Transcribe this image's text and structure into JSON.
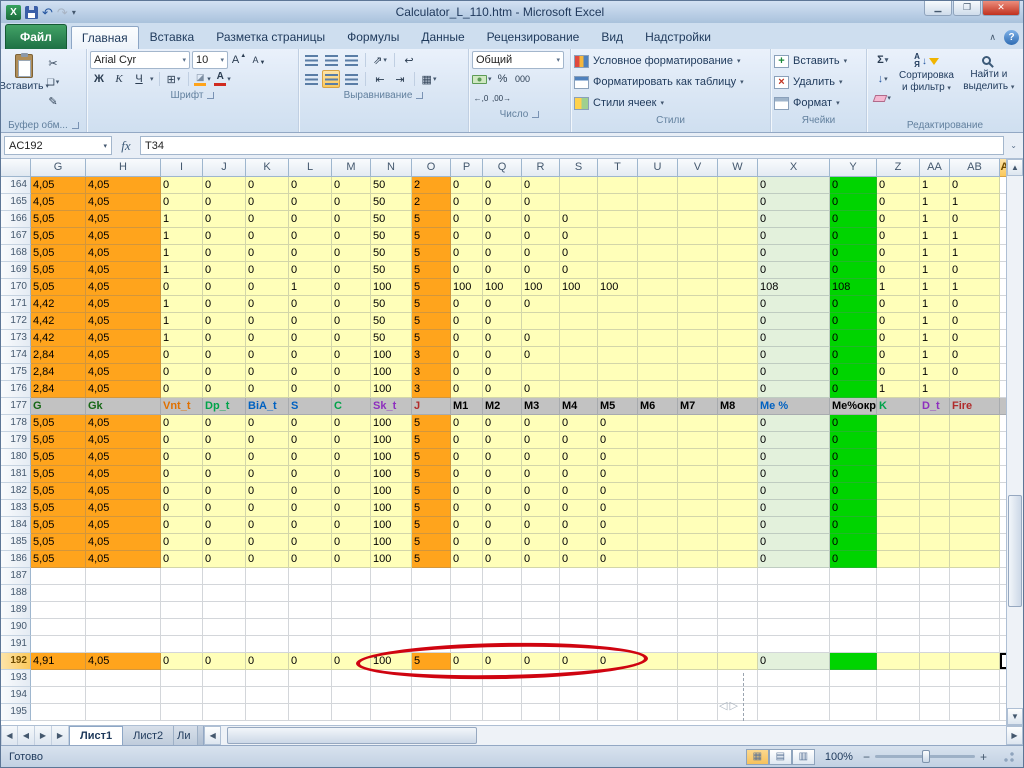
{
  "titlebar": {
    "title": "Calculator_L_110.htm  -  Microsoft Excel"
  },
  "ribbon": {
    "tabs": [
      "Файл",
      "Главная",
      "Вставка",
      "Разметка страницы",
      "Формулы",
      "Данные",
      "Рецензирование",
      "Вид",
      "Надстройки"
    ],
    "active_tab": "Главная",
    "clipboard": {
      "label": "Буфер обм...",
      "paste": "Вставить"
    },
    "font": {
      "label": "Шрифт",
      "name": "Arial Cyr",
      "size": "10",
      "bold": "Ж",
      "italic": "К",
      "underline": "Ч",
      "letter": "А"
    },
    "alignment": {
      "label": "Выравнивание"
    },
    "number": {
      "label": "Число",
      "format": "Общий",
      "percent": "%",
      "thousands": "000",
      "increase_decimal": "←,0",
      "decrease_decimal": ",00→"
    },
    "styles": {
      "label": "Стили",
      "conditional": "Условное форматирование",
      "format_table": "Форматировать как таблицу",
      "cell_styles": "Стили ячеек"
    },
    "cells": {
      "label": "Ячейки",
      "insert": "Вставить",
      "delete": "Удалить",
      "format": "Формат"
    },
    "editing": {
      "label": "Редактирование",
      "autosum": "Σ",
      "sort_line1": "Сортировка",
      "sort_line2": "и фильтр",
      "find_line1": "Найти и",
      "find_line2": "выделить"
    }
  },
  "formula_bar": {
    "name_box": "AC192",
    "fx_label": "fx",
    "value": "T34"
  },
  "grid": {
    "columns": [
      "G",
      "H",
      "I",
      "J",
      "K",
      "L",
      "M",
      "N",
      "O",
      "P",
      "Q",
      "R",
      "S",
      "T",
      "U",
      "V",
      "W",
      "X",
      "Y",
      "Z",
      "AA",
      "AB",
      "AC"
    ],
    "highlight_column": "AC",
    "active_cell": {
      "row": 192,
      "col": "AC"
    },
    "palette": {
      "orange": "#FFA41C",
      "yellow": "#FFFFB9",
      "pale_green": "#E3F1DC",
      "bright_green": "#00D400",
      "header_gray": "#C2C2C2",
      "annotation_red": "#CF0410"
    },
    "col_fills": [
      "orange",
      "orange",
      "yellow",
      "yellow",
      "yellow",
      "yellow",
      "yellow",
      "yellow",
      "orange",
      "yellow",
      "yellow",
      "yellow",
      "yellow",
      "yellow",
      "yellow",
      "yellow",
      "yellow",
      "pale_green",
      "bright_green",
      "yellow",
      "yellow",
      "yellow",
      "none"
    ],
    "header_row_colors": [
      "#156715",
      "#156715",
      "#E07000",
      "#00A34A",
      "#0061C1",
      "#0061C1",
      "#00A34A",
      "#8E2FBE",
      "#B02B2B",
      "#000000",
      "#000000",
      "#000000",
      "#000000",
      "#000000",
      "#000000",
      "#000000",
      "#000000",
      "#0061C1",
      "#000000",
      "#00A34A",
      "#8E2FBE",
      "#B02B2B",
      ""
    ],
    "rows": [
      {
        "n": 164,
        "t": "d",
        "c": [
          "4,05",
          "4,05",
          "0",
          "0",
          "0",
          "0",
          "0",
          "50",
          "2",
          "0",
          "0",
          "0",
          "",
          "",
          "",
          "",
          "",
          "0",
          "0",
          "0",
          "1",
          "0",
          ""
        ]
      },
      {
        "n": 165,
        "t": "d",
        "c": [
          "4,05",
          "4,05",
          "0",
          "0",
          "0",
          "0",
          "0",
          "50",
          "2",
          "0",
          "0",
          "0",
          "",
          "",
          "",
          "",
          "",
          "0",
          "0",
          "0",
          "1",
          "1",
          ""
        ]
      },
      {
        "n": 166,
        "t": "d",
        "c": [
          "5,05",
          "4,05",
          "1",
          "0",
          "0",
          "0",
          "0",
          "50",
          "5",
          "0",
          "0",
          "0",
          "0",
          "",
          "",
          "",
          "",
          "0",
          "0",
          "0",
          "1",
          "0",
          ""
        ]
      },
      {
        "n": 167,
        "t": "d",
        "c": [
          "5,05",
          "4,05",
          "1",
          "0",
          "0",
          "0",
          "0",
          "50",
          "5",
          "0",
          "0",
          "0",
          "0",
          "",
          "",
          "",
          "",
          "0",
          "0",
          "0",
          "1",
          "1",
          ""
        ]
      },
      {
        "n": 168,
        "t": "d",
        "c": [
          "5,05",
          "4,05",
          "1",
          "0",
          "0",
          "0",
          "0",
          "50",
          "5",
          "0",
          "0",
          "0",
          "0",
          "",
          "",
          "",
          "",
          "0",
          "0",
          "0",
          "1",
          "1",
          ""
        ]
      },
      {
        "n": 169,
        "t": "d",
        "c": [
          "5,05",
          "4,05",
          "1",
          "0",
          "0",
          "0",
          "0",
          "50",
          "5",
          "0",
          "0",
          "0",
          "0",
          "",
          "",
          "",
          "",
          "0",
          "0",
          "0",
          "1",
          "0",
          ""
        ]
      },
      {
        "n": 170,
        "t": "d",
        "c": [
          "5,05",
          "4,05",
          "0",
          "0",
          "0",
          "1",
          "0",
          "100",
          "5",
          "100",
          "100",
          "100",
          "100",
          "100",
          "",
          "",
          "",
          "108",
          "108",
          "1",
          "1",
          "1",
          ""
        ]
      },
      {
        "n": 171,
        "t": "d",
        "c": [
          "4,42",
          "4,05",
          "1",
          "0",
          "0",
          "0",
          "0",
          "50",
          "5",
          "0",
          "0",
          "0",
          "",
          "",
          "",
          "",
          "",
          "0",
          "0",
          "0",
          "1",
          "0",
          ""
        ]
      },
      {
        "n": 172,
        "t": "d",
        "c": [
          "4,42",
          "4,05",
          "1",
          "0",
          "0",
          "0",
          "0",
          "50",
          "5",
          "0",
          "0",
          "",
          "",
          "",
          "",
          "",
          "",
          "0",
          "0",
          "0",
          "1",
          "0",
          ""
        ]
      },
      {
        "n": 173,
        "t": "d",
        "c": [
          "4,42",
          "4,05",
          "1",
          "0",
          "0",
          "0",
          "0",
          "50",
          "5",
          "0",
          "0",
          "0",
          "",
          "",
          "",
          "",
          "",
          "0",
          "0",
          "0",
          "1",
          "0",
          ""
        ]
      },
      {
        "n": 174,
        "t": "d",
        "c": [
          "2,84",
          "4,05",
          "0",
          "0",
          "0",
          "0",
          "0",
          "100",
          "3",
          "0",
          "0",
          "0",
          "",
          "",
          "",
          "",
          "",
          "0",
          "0",
          "0",
          "1",
          "0",
          ""
        ]
      },
      {
        "n": 175,
        "t": "d",
        "c": [
          "2,84",
          "4,05",
          "0",
          "0",
          "0",
          "0",
          "0",
          "100",
          "3",
          "0",
          "0",
          "",
          "",
          "",
          "",
          "",
          "",
          "0",
          "0",
          "0",
          "1",
          "0",
          ""
        ]
      },
      {
        "n": 176,
        "t": "d",
        "c": [
          "2,84",
          "4,05",
          "0",
          "0",
          "0",
          "0",
          "0",
          "100",
          "3",
          "0",
          "0",
          "0",
          "",
          "",
          "",
          "",
          "",
          "0",
          "0",
          "1",
          "1",
          "",
          ""
        ]
      },
      {
        "n": 177,
        "t": "h",
        "c": [
          "G",
          "Gk",
          "Vnt_t",
          "Dp_t",
          "BiA_t",
          "S",
          "C",
          "Sk_t",
          "J",
          "M1",
          "M2",
          "M3",
          "M4",
          "M5",
          "M6",
          "M7",
          "M8",
          "Me %",
          "Ме%окр.",
          "K",
          "D_t",
          "Fire",
          ""
        ]
      },
      {
        "n": 178,
        "t": "d",
        "c": [
          "5,05",
          "4,05",
          "0",
          "0",
          "0",
          "0",
          "0",
          "100",
          "5",
          "0",
          "0",
          "0",
          "0",
          "0",
          "",
          "",
          "",
          "0",
          "0",
          "",
          "",
          "",
          ""
        ]
      },
      {
        "n": 179,
        "t": "d",
        "c": [
          "5,05",
          "4,05",
          "0",
          "0",
          "0",
          "0",
          "0",
          "100",
          "5",
          "0",
          "0",
          "0",
          "0",
          "0",
          "",
          "",
          "",
          "0",
          "0",
          "",
          "",
          "",
          ""
        ]
      },
      {
        "n": 180,
        "t": "d",
        "c": [
          "5,05",
          "4,05",
          "0",
          "0",
          "0",
          "0",
          "0",
          "100",
          "5",
          "0",
          "0",
          "0",
          "0",
          "0",
          "",
          "",
          "",
          "0",
          "0",
          "",
          "",
          "",
          ""
        ]
      },
      {
        "n": 181,
        "t": "d",
        "c": [
          "5,05",
          "4,05",
          "0",
          "0",
          "0",
          "0",
          "0",
          "100",
          "5",
          "0",
          "0",
          "0",
          "0",
          "0",
          "",
          "",
          "",
          "0",
          "0",
          "",
          "",
          "",
          ""
        ]
      },
      {
        "n": 182,
        "t": "d",
        "c": [
          "5,05",
          "4,05",
          "0",
          "0",
          "0",
          "0",
          "0",
          "100",
          "5",
          "0",
          "0",
          "0",
          "0",
          "0",
          "",
          "",
          "",
          "0",
          "0",
          "",
          "",
          "",
          ""
        ]
      },
      {
        "n": 183,
        "t": "d",
        "c": [
          "5,05",
          "4,05",
          "0",
          "0",
          "0",
          "0",
          "0",
          "100",
          "5",
          "0",
          "0",
          "0",
          "0",
          "0",
          "",
          "",
          "",
          "0",
          "0",
          "",
          "",
          "",
          ""
        ]
      },
      {
        "n": 184,
        "t": "d",
        "c": [
          "5,05",
          "4,05",
          "0",
          "0",
          "0",
          "0",
          "0",
          "100",
          "5",
          "0",
          "0",
          "0",
          "0",
          "0",
          "",
          "",
          "",
          "0",
          "0",
          "",
          "",
          "",
          ""
        ]
      },
      {
        "n": 185,
        "t": "d",
        "c": [
          "5,05",
          "4,05",
          "0",
          "0",
          "0",
          "0",
          "0",
          "100",
          "5",
          "0",
          "0",
          "0",
          "0",
          "0",
          "",
          "",
          "",
          "0",
          "0",
          "",
          "",
          "",
          ""
        ]
      },
      {
        "n": 186,
        "t": "d",
        "c": [
          "5,05",
          "4,05",
          "0",
          "0",
          "0",
          "0",
          "0",
          "100",
          "5",
          "0",
          "0",
          "0",
          "0",
          "0",
          "",
          "",
          "",
          "0",
          "0",
          "",
          "",
          "",
          ""
        ]
      },
      {
        "n": 187,
        "t": "e"
      },
      {
        "n": 188,
        "t": "e"
      },
      {
        "n": 189,
        "t": "e"
      },
      {
        "n": 190,
        "t": "e"
      },
      {
        "n": 191,
        "t": "e"
      },
      {
        "n": 192,
        "t": "d",
        "c": [
          "4,91",
          "4,05",
          "0",
          "0",
          "0",
          "0",
          "0",
          "100",
          "5",
          "0",
          "0",
          "0",
          "0",
          "0",
          "",
          "",
          "",
          "0",
          "",
          "",
          "",
          "",
          ""
        ]
      },
      {
        "n": 193,
        "t": "e"
      },
      {
        "n": 194,
        "t": "e"
      },
      {
        "n": 195,
        "t": "e"
      }
    ]
  },
  "sheet_bar": {
    "tabs": [
      "Лист1",
      "Лист2",
      "Ли"
    ],
    "active": "Лист1"
  },
  "status_bar": {
    "ready": "Готово",
    "zoom": "100%"
  }
}
